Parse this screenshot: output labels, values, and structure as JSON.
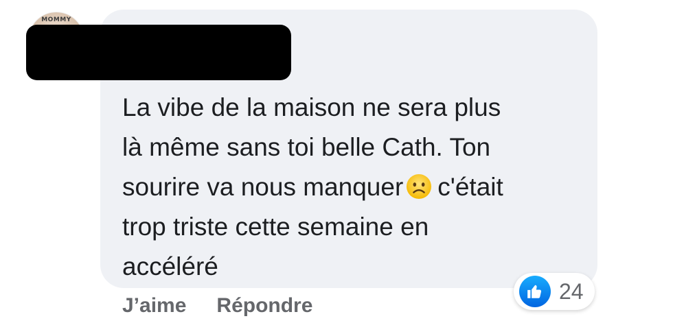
{
  "comment": {
    "text_line1": "La vibe de la maison ne sera plus",
    "text_line2": "là même sans toi belle Cath. Ton",
    "text_line3_before": "sourire va nous manquer",
    "text_line3_after": "c'était",
    "text_line4": "trop triste cette semaine en",
    "text_line5": "accéléré",
    "emoji_icon": "sad-face-emoji"
  },
  "avatar": {
    "badge_text": "MOMMY"
  },
  "actions": {
    "like_label": "J’aime",
    "reply_label": "Répondre"
  },
  "reactions": {
    "icon": "thumbs-up-icon",
    "count": "24",
    "accent": "#1877f2"
  }
}
